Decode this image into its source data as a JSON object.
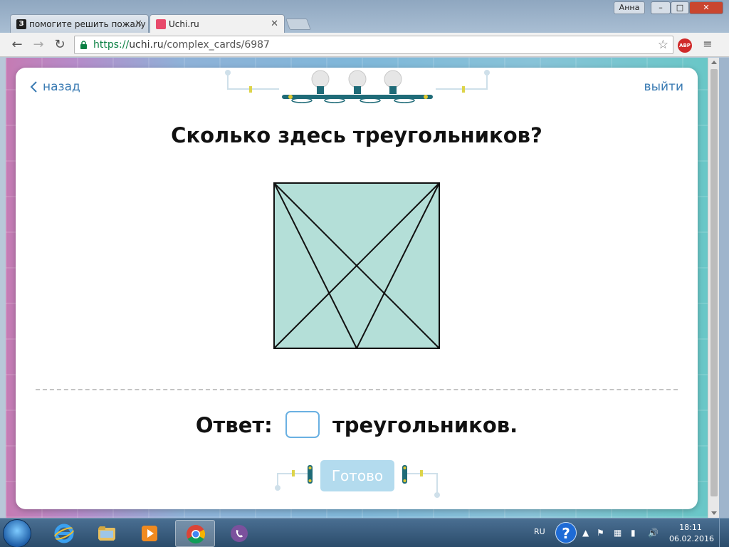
{
  "browser": {
    "tabs": [
      {
        "title": "помогите решить пожалу",
        "favicon": "З",
        "active": false
      },
      {
        "title": "Uchi.ru",
        "active": true
      }
    ],
    "user": "Анна",
    "url": {
      "scheme": "https://",
      "host": "uchi.ru",
      "path": "/complex_cards/6987"
    },
    "extension": "ABP"
  },
  "page": {
    "back_label": "назад",
    "exit_label": "выйти",
    "question": "Сколько здесь треугольников?",
    "answer_prefix": "Ответ:",
    "answer_suffix": "треугольников.",
    "answer_value": "",
    "done_label": "Готово",
    "figure": {
      "shape": "square with both diagonals and two lines from the top corners to the midpoint of the bottom side",
      "fill": "#b4dfd8",
      "stroke": "#111111"
    }
  },
  "taskbar": {
    "lang": "RU",
    "time": "18:11",
    "date": "06.02.2016",
    "apps": [
      "internet-explorer",
      "file-explorer",
      "media-player",
      "chrome",
      "viber"
    ]
  },
  "colors": {
    "link": "#3a7bb3",
    "done_button": "#b3dbee",
    "input_border": "#6ab0e2"
  }
}
